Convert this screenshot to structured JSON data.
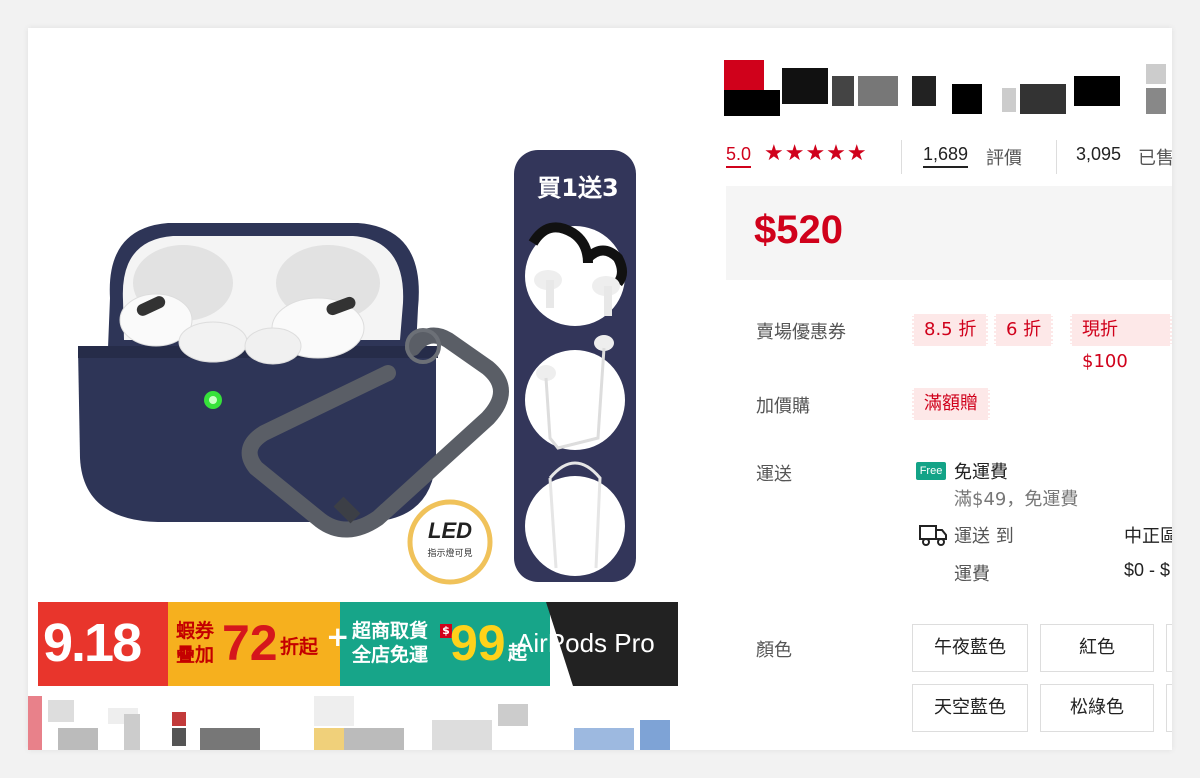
{
  "product_image": {
    "promo_badge": "買1送3",
    "led_badge_title": "LED",
    "led_badge_sub": "指示燈可見"
  },
  "banner": {
    "date": "9.18",
    "coupon_line1": "蝦券",
    "coupon_line2": "疊加",
    "coupon_number": "72",
    "coupon_suffix": "折起",
    "plus": "+",
    "pickup_line1": "超商取貨",
    "pickup_line2": "全店免運",
    "pickup_number": "99",
    "pickup_suffix": "起",
    "dollar_sign": "$",
    "product_name": "AirPods Pro"
  },
  "rating": {
    "score": "5.0",
    "stars": "★★★★★",
    "review_count": "1,689",
    "review_label": "評價",
    "sold_count": "3,095",
    "sold_label": "已售"
  },
  "price": "$520",
  "coupons": {
    "label": "賣場優惠券",
    "items": [
      "8.5 折",
      "6 折",
      "現折$100"
    ]
  },
  "addon": {
    "label": "加價購",
    "item": "滿額贈"
  },
  "shipping": {
    "label": "運送",
    "free_icon": "Free",
    "title": "免運費",
    "subtitle": "滿$49，免運費",
    "ship_to_label": "運送 到",
    "destination": "中正區",
    "fee_label": "運費",
    "fee_value": "$0 - $"
  },
  "colors": {
    "label": "顏色",
    "options": [
      "午夜藍色",
      "紅色",
      "天空藍色",
      "松綠色"
    ]
  },
  "accent": {
    "brand_red": "#d0011b",
    "free_green": "#13a387",
    "case_navy": "#2e3557"
  }
}
